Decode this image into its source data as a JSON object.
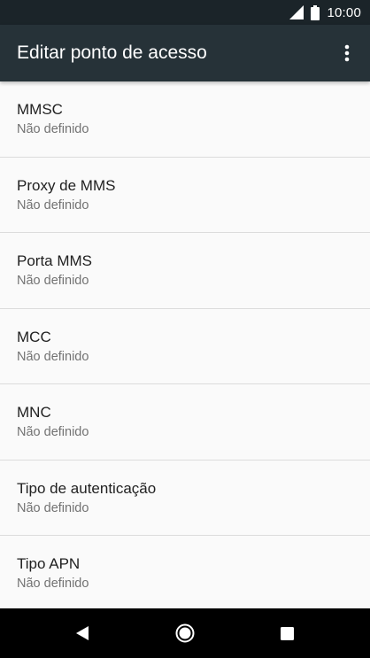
{
  "status_bar": {
    "time": "10:00",
    "icons": [
      "signal-icon",
      "battery-icon"
    ]
  },
  "app_bar": {
    "title": "Editar ponto de acesso",
    "menu_icon": "overflow-menu-icon"
  },
  "settings": [
    {
      "label": "MMSC",
      "value": "Não definido"
    },
    {
      "label": "Proxy de MMS",
      "value": "Não definido"
    },
    {
      "label": "Porta MMS",
      "value": "Não definido"
    },
    {
      "label": "MCC",
      "value": "Não definido"
    },
    {
      "label": "MNC",
      "value": "Não definido"
    },
    {
      "label": "Tipo de autenticação",
      "value": "Não definido"
    },
    {
      "label": "Tipo APN",
      "value": "Não definido"
    }
  ],
  "nav_bar": {
    "icons": [
      "back-icon",
      "home-icon",
      "recents-icon"
    ]
  },
  "colors": {
    "app_bar": "#263238",
    "status_bar": "#1b2429",
    "background": "#fafafa",
    "primary_text": "#212121",
    "secondary_text": "#737373"
  }
}
